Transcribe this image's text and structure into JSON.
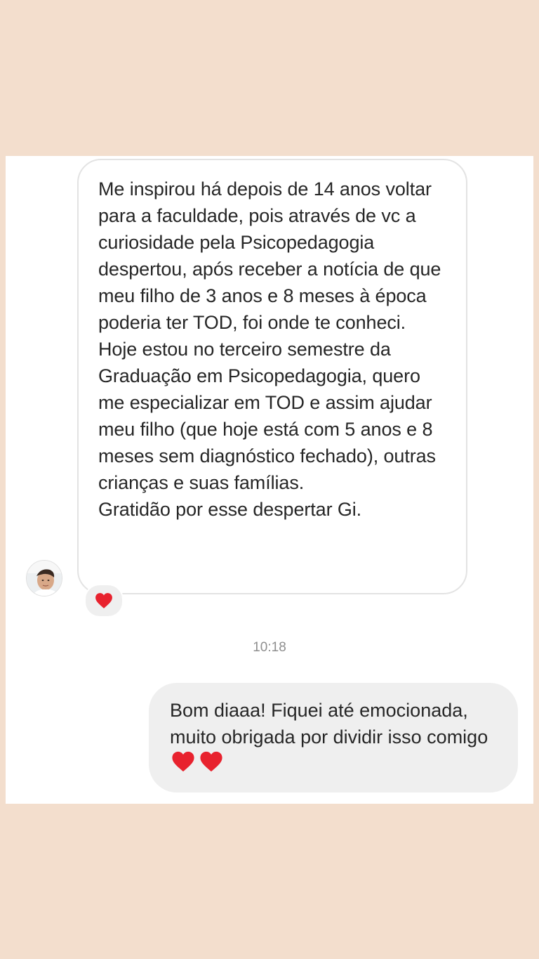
{
  "conversation": {
    "incoming": {
      "paragraphs": [
        "Me inspirou há depois de 14 anos voltar para a faculdade, pois através de vc a curiosidade pela Psicopedagogia despertou, após receber a notícia de que meu filho de 3 anos e 8 meses à época poderia ter TOD, foi onde te conheci.",
        "Hoje estou no terceiro semestre da Graduação em Psicopedagogia, quero me especializar em TOD e assim ajudar meu filho (que hoje está com 5 anos e 8 meses sem diagnóstico fechado), outras crianças e suas famílias.",
        "Gratidão por esse despertar Gi."
      ],
      "reaction_icon": "red-heart-icon"
    },
    "timestamp": "10:18",
    "outgoing": {
      "text": "Bom diaaa! Fiquei até emocionada, muito obrigada por dividir isso comigo",
      "trailing_icons": [
        "red-heart-icon",
        "red-heart-icon"
      ]
    }
  },
  "colors": {
    "page_background": "#f3decd",
    "card_background": "#ffffff",
    "incoming_border": "#e3e3e3",
    "outgoing_bubble": "#efefef",
    "text": "#262626",
    "timestamp": "#8e8e8e",
    "heart": "#e8222e"
  }
}
